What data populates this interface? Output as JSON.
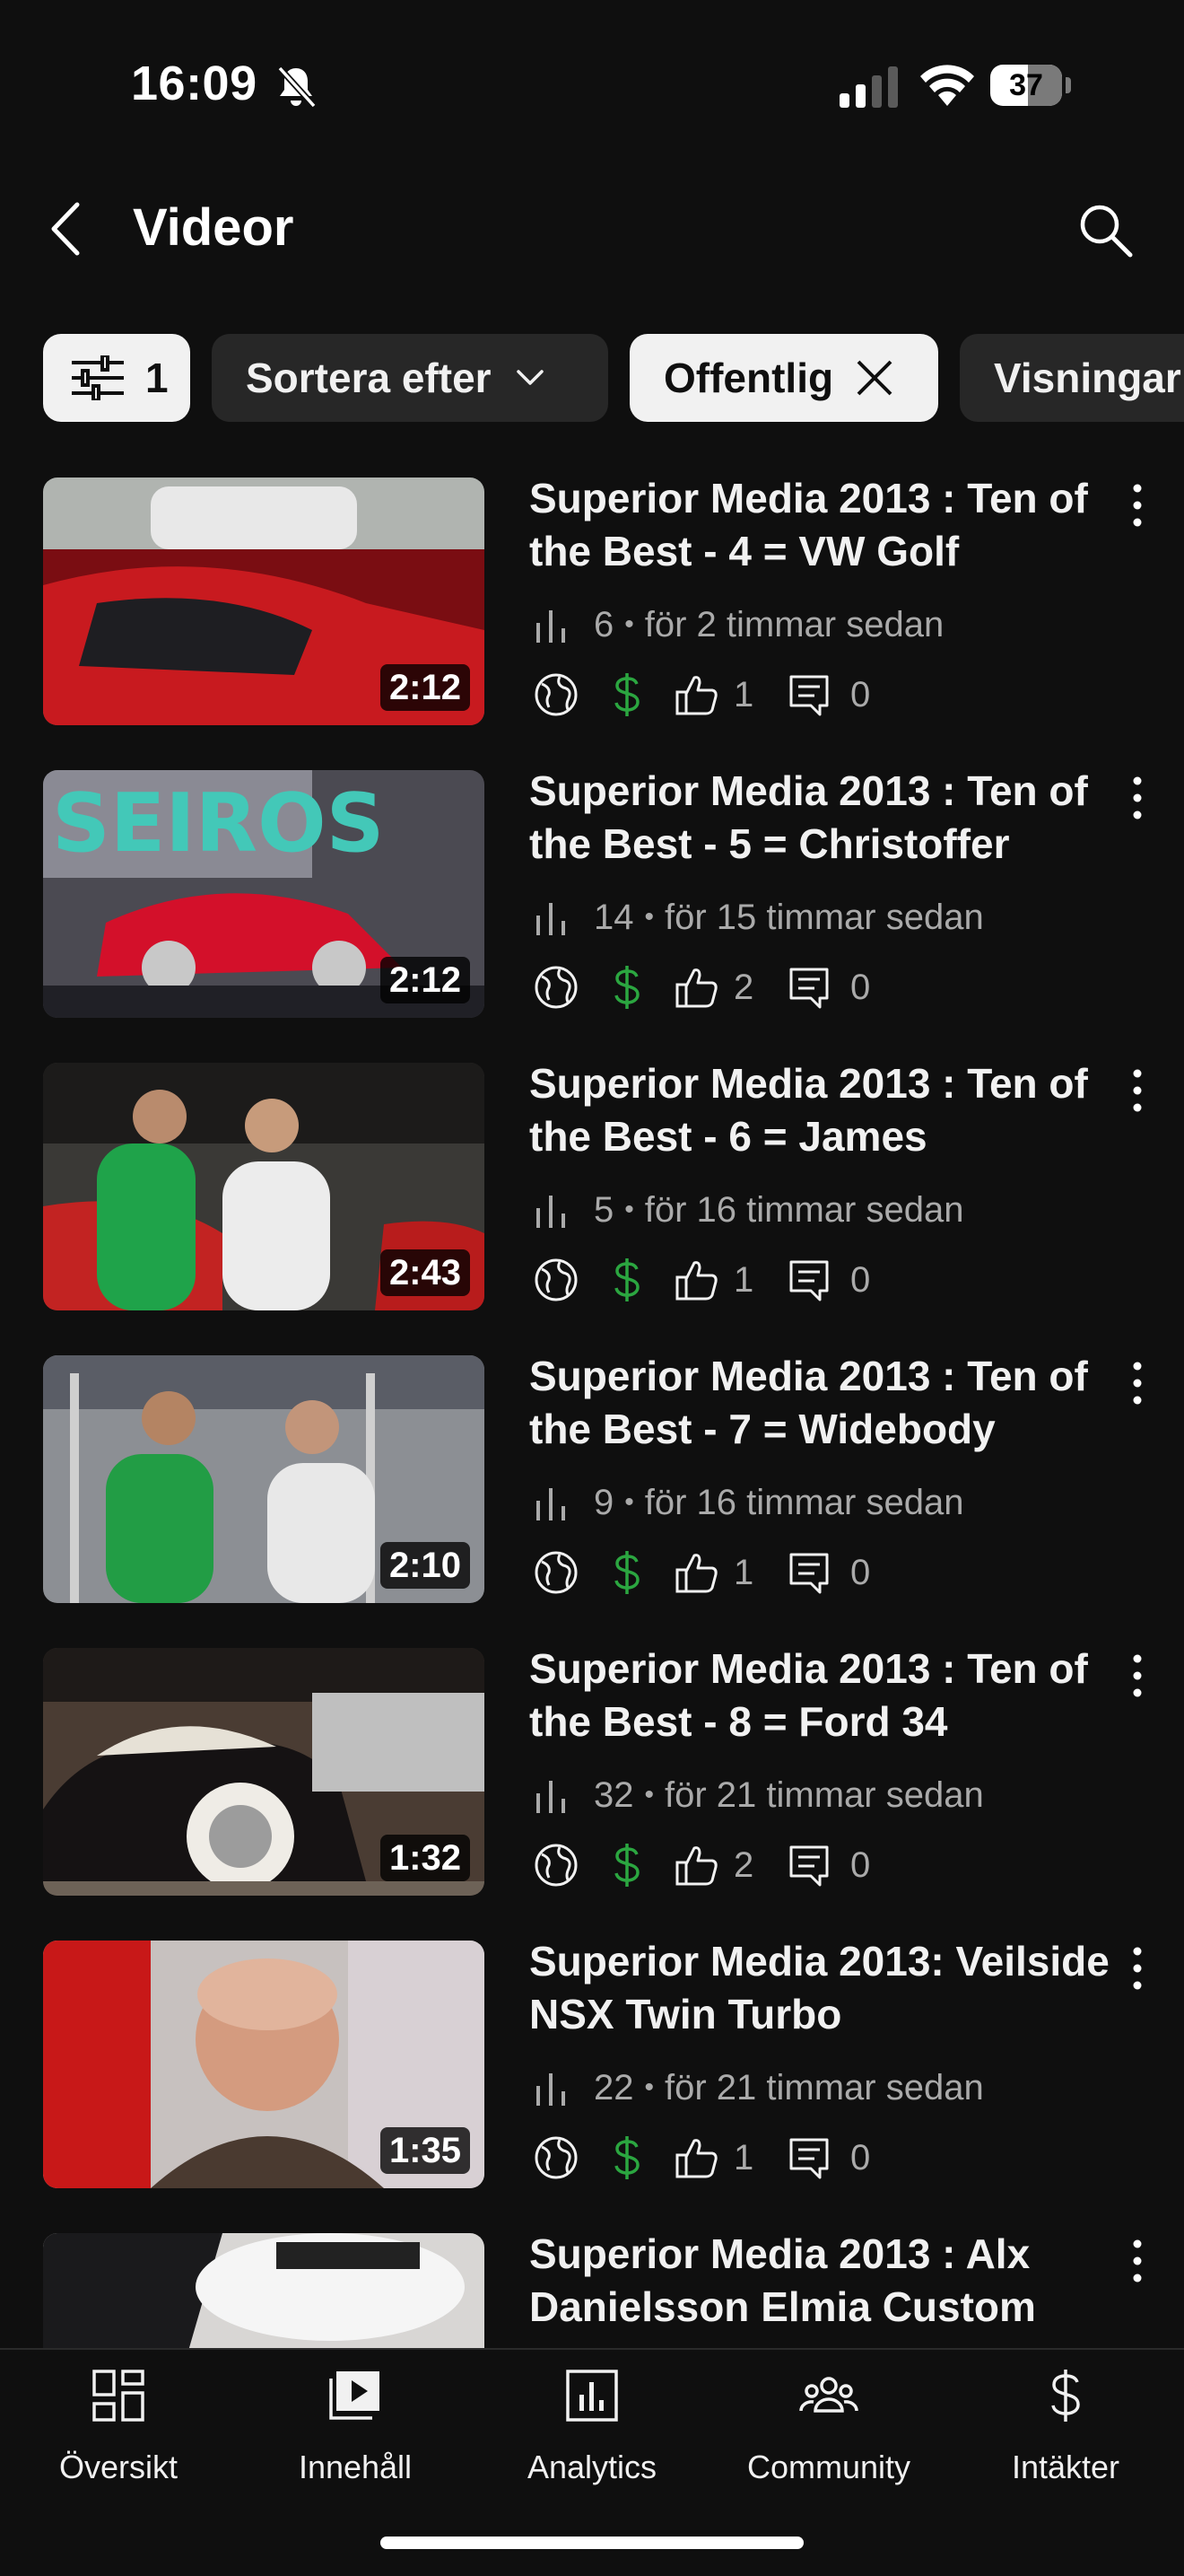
{
  "status_bar": {
    "time": "16:09",
    "battery": "37",
    "icons": [
      "bell-slash-icon",
      "signal-icon",
      "wifi-icon",
      "battery-icon"
    ]
  },
  "header": {
    "title": "Videor",
    "back_icon": "chevron-left-icon",
    "search_icon": "search-icon"
  },
  "filters": {
    "filter_count": "1",
    "sort_label": "Sortera efter",
    "active_chip": "Offentlig",
    "next_chip": "Visningar"
  },
  "videos": [
    {
      "title": "Superior Media 2013 : Ten of the Best - 4 =  VW Golf",
      "duration": "2:12",
      "views": "6",
      "time": "för 2 timmar sedan",
      "likes": "1",
      "comments": "0"
    },
    {
      "title": "Superior Media 2013 : Ten of the Best - 5 = Christoffer",
      "duration": "2:12",
      "views": "14",
      "time": "för 15 timmar sedan",
      "likes": "2",
      "comments": "0"
    },
    {
      "title": "Superior Media 2013 : Ten of the Best - 6 = James",
      "duration": "2:43",
      "views": "5",
      "time": "för 16 timmar sedan",
      "likes": "1",
      "comments": "0"
    },
    {
      "title": "Superior Media 2013 : Ten of the Best - 7 = Widebody",
      "duration": "2:10",
      "views": "9",
      "time": "för 16 timmar sedan",
      "likes": "1",
      "comments": "0"
    },
    {
      "title": "Superior Media 2013 : Ten of the Best - 8 = Ford 34",
      "duration": "1:32",
      "views": "32",
      "time": "för 21 timmar sedan",
      "likes": "2",
      "comments": "0"
    },
    {
      "title": "Superior Media 2013: Veilside NSX Twin Turbo",
      "duration": "1:35",
      "views": "22",
      "time": "för 21 timmar sedan",
      "likes": "1",
      "comments": "0"
    },
    {
      "title": "Superior Media 2013 :  Alx Danielsson Elmia Custom",
      "duration": "",
      "views": "",
      "time": "",
      "likes": "",
      "comments": ""
    }
  ],
  "bottom_nav": [
    {
      "label": "Översikt",
      "icon": "dashboard-icon"
    },
    {
      "label": "Innehåll",
      "icon": "content-icon"
    },
    {
      "label": "Analytics",
      "icon": "analytics-icon"
    },
    {
      "label": "Community",
      "icon": "community-icon"
    },
    {
      "label": "Intäkter",
      "icon": "earn-icon"
    }
  ],
  "colors": {
    "background": "#0f0f0f",
    "chip_active": "#f1f1f1",
    "chip_inactive": "#272727",
    "monetization_green": "#2ba640",
    "secondary_text": "#aaaaaa"
  }
}
